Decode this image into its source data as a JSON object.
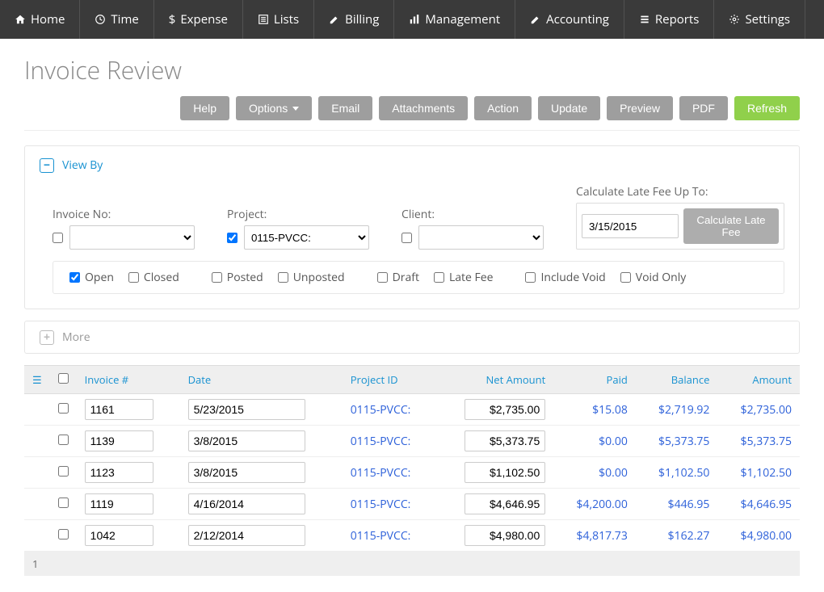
{
  "nav": {
    "home": "Home",
    "time": "Time",
    "expense": "Expense",
    "lists": "Lists",
    "billing": "Billing",
    "management": "Management",
    "accounting": "Accounting",
    "reports": "Reports",
    "settings": "Settings"
  },
  "page": {
    "title": "Invoice Review"
  },
  "actions": {
    "help": "Help",
    "options": "Options",
    "email": "Email",
    "attachments": "Attachments",
    "action": "Action",
    "update": "Update",
    "preview": "Preview",
    "pdf": "PDF",
    "refresh": "Refresh"
  },
  "viewby": {
    "title": "View By",
    "invoice_no_label": "Invoice No:",
    "project_label": "Project:",
    "project_value": "0115-PVCC:",
    "client_label": "Client:",
    "latefee_label": "Calculate Late Fee Up To:",
    "latefee_date": "3/15/2015",
    "calc_btn": "Calculate Late Fee",
    "flags": {
      "open": "Open",
      "closed": "Closed",
      "posted": "Posted",
      "unposted": "Unposted",
      "draft": "Draft",
      "late_fee": "Late Fee",
      "include_void": "Include Void",
      "void_only": "Void Only"
    }
  },
  "more": {
    "label": "More"
  },
  "table": {
    "headers": {
      "invoice": "Invoice #",
      "date": "Date",
      "project": "Project ID",
      "net": "Net Amount",
      "paid": "Paid",
      "balance": "Balance",
      "amount": "Amount"
    },
    "rows": [
      {
        "inv": "1161",
        "date": "5/23/2015",
        "proj": "0115-PVCC:",
        "net": "$2,735.00",
        "paid": "$15.08",
        "bal": "$2,719.92",
        "amt": "$2,735.00"
      },
      {
        "inv": "1139",
        "date": "3/8/2015",
        "proj": "0115-PVCC:",
        "net": "$5,373.75",
        "paid": "$0.00",
        "bal": "$5,373.75",
        "amt": "$5,373.75"
      },
      {
        "inv": "1123",
        "date": "3/8/2015",
        "proj": "0115-PVCC:",
        "net": "$1,102.50",
        "paid": "$0.00",
        "bal": "$1,102.50",
        "amt": "$1,102.50"
      },
      {
        "inv": "1119",
        "date": "4/16/2014",
        "proj": "0115-PVCC:",
        "net": "$4,646.95",
        "paid": "$4,200.00",
        "bal": "$446.95",
        "amt": "$4,646.95"
      },
      {
        "inv": "1042",
        "date": "2/12/2014",
        "proj": "0115-PVCC:",
        "net": "$4,980.00",
        "paid": "$4,817.73",
        "bal": "$162.27",
        "amt": "$4,980.00"
      }
    ],
    "footer_page": "1"
  }
}
